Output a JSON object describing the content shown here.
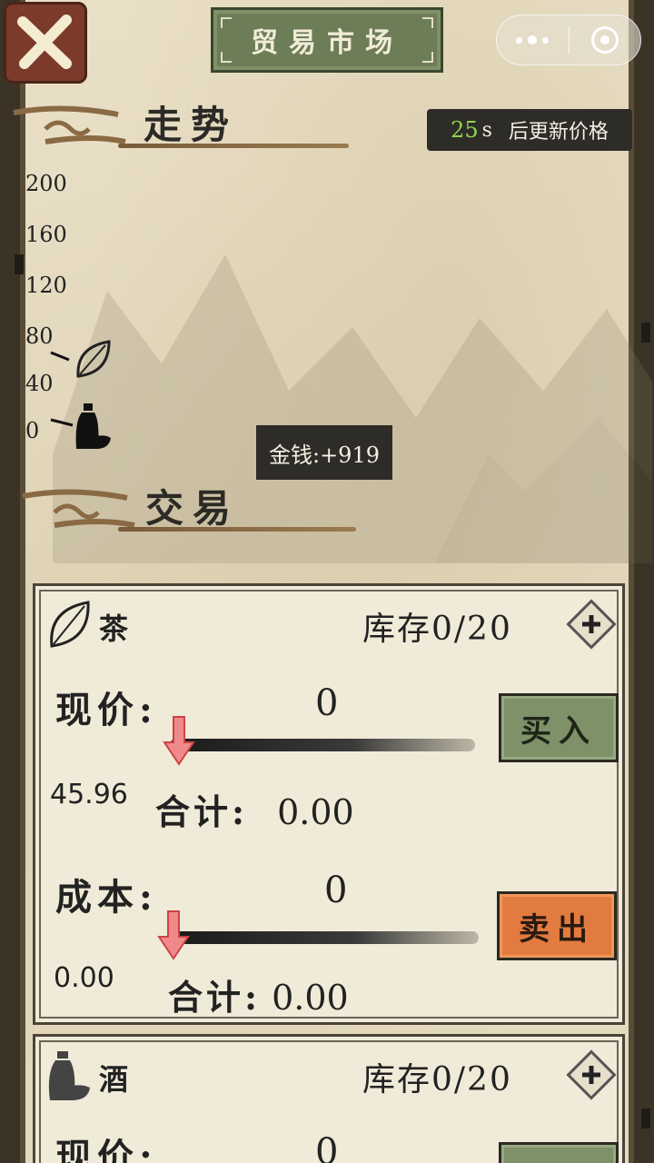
{
  "header": {
    "title": "贸易市场",
    "close_icon": "close-x-icon",
    "capsule": {
      "more_icon": "more-dots-icon",
      "close_icon": "target-circle-icon"
    }
  },
  "trend": {
    "title": "走势",
    "timer": {
      "seconds": "25",
      "unit": "s",
      "text": "后更新价格"
    },
    "y_ticks": [
      "200",
      "160",
      "120",
      "80",
      "40",
      "0"
    ],
    "markers": [
      {
        "item": "茶",
        "icon": "tea-leaf-icon"
      },
      {
        "item": "酒",
        "icon": "wine-jar-icon"
      }
    ],
    "money": "金钱:+919"
  },
  "trade": {
    "title": "交易",
    "cards": [
      {
        "name": "茶",
        "icon": "tea-leaf-icon",
        "stock": "库存0/20",
        "price_label": "现价:",
        "price_qty": "0",
        "price_value": "45.96",
        "price_total_label": "合计:",
        "price_total": "0.00",
        "buy_label": "买入",
        "cost_label": "成本:",
        "cost_qty": "0",
        "cost_value": "0.00",
        "cost_total_label": "合计:",
        "cost_total": "0.00",
        "sell_label": "卖出"
      },
      {
        "name": "酒",
        "icon": "wine-jar-icon",
        "stock": "库存0/20",
        "price_label": "现价:",
        "price_qty": "0"
      }
    ]
  },
  "colors": {
    "parchment": "#e8dec4",
    "buy_button": "#7e9168",
    "sell_button": "#e27b3f",
    "timer_seconds": "#8fd64a",
    "close_button": "#7b3a2a"
  }
}
